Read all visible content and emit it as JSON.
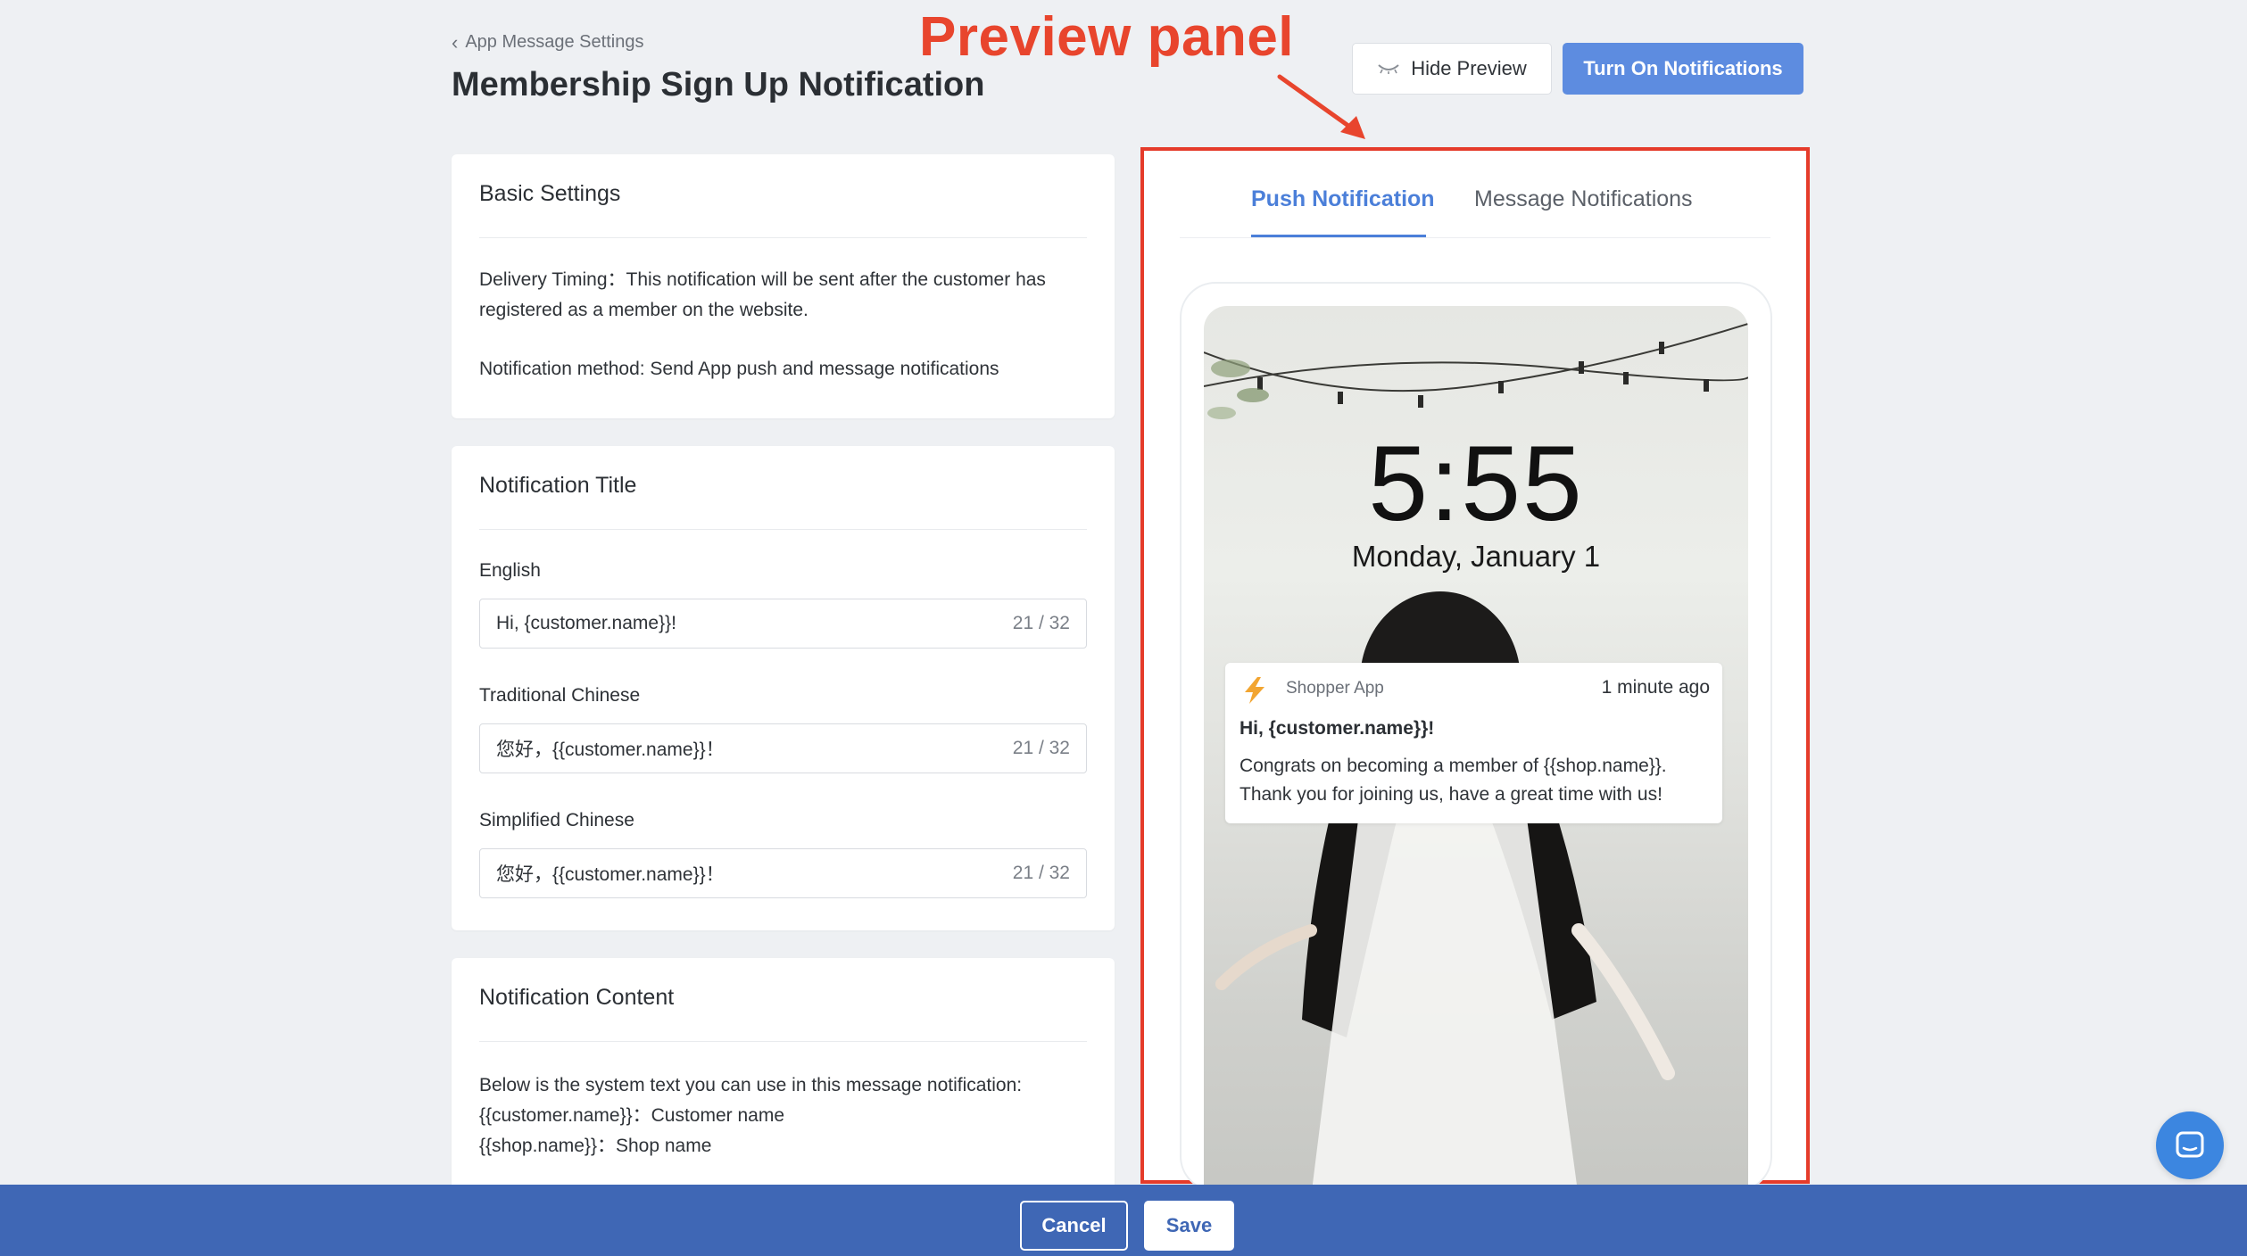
{
  "header": {
    "breadcrumb": "App Message Settings",
    "title": "Membership Sign Up Notification",
    "hide_preview_label": "Hide Preview",
    "turn_on_label": "Turn On Notifications"
  },
  "annotation": {
    "label": "Preview panel",
    "color": "#e8452d"
  },
  "basic_settings": {
    "title": "Basic Settings",
    "delivery_timing": "Delivery Timing：This notification will be sent after the customer has registered as a member on the website.",
    "method": "Notification method: Send App push and message notifications"
  },
  "notification_title": {
    "title": "Notification Title",
    "fields": [
      {
        "label": "English",
        "value": "Hi, {customer.name}}!",
        "count": "21 / 32"
      },
      {
        "label": "Traditional Chinese",
        "value": "您好，{{customer.name}}！",
        "count": "21 / 32"
      },
      {
        "label": "Simplified Chinese",
        "value": "您好，{{customer.name}}！",
        "count": "21 / 32"
      }
    ]
  },
  "notification_content": {
    "title": "Notification Content",
    "intro": "Below is the system text you can use in this message notification:",
    "var_customer": "{{customer.name}}：Customer name",
    "var_shop": "{{shop.name}}：Shop name"
  },
  "preview": {
    "tabs": [
      "Push Notification",
      "Message Notifications"
    ],
    "active_tab": "Push Notification",
    "clock": "5:55",
    "date": "Monday, January 1",
    "notification": {
      "app_name": "Shopper App",
      "time": "1 minute ago",
      "title": "Hi, {customer.name}}!",
      "body": "Congrats on becoming a member of {{shop.name}}. Thank you for joining us, have a great time with us!"
    }
  },
  "footer": {
    "cancel_label": "Cancel",
    "save_label": "Save"
  },
  "colors": {
    "accent": "#5d8ce0",
    "footer": "#3f67b5",
    "highlight_border": "#e53b2a"
  },
  "icons": [
    "chevron-left-icon",
    "eye-closed-icon",
    "shopper-app-bolt-icon",
    "chat-icon"
  ]
}
